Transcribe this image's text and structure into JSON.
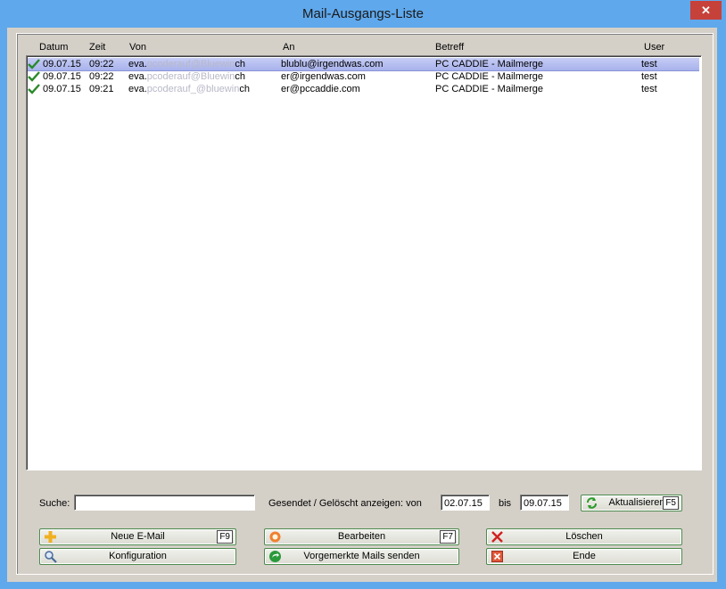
{
  "window": {
    "title": "Mail-Ausgangs-Liste",
    "close_glyph": "✕"
  },
  "columns": [
    "Datum",
    "Zeit",
    "Von",
    "An",
    "Betreff",
    "User"
  ],
  "rows": [
    {
      "datum": "09.07.15",
      "zeit": "09:22",
      "von_start": "eva.",
      "von_blur": "pcoderauf@Bluewin",
      "von_end": "ch",
      "an": "blublu@irgendwas.com",
      "betreff": "PC CADDIE - Mailmerge",
      "user": "test",
      "selected": true
    },
    {
      "datum": "09.07.15",
      "zeit": "09:22",
      "von_start": "eva.",
      "von_blur": "pcoderauf@Bluewin",
      "von_end": "ch",
      "an": "er@irgendwas.com",
      "betreff": "PC CADDIE - Mailmerge",
      "user": "test",
      "selected": false
    },
    {
      "datum": "09.07.15",
      "zeit": "09:21",
      "von_start": "eva.",
      "von_blur": "pcoderauf_@bluewin",
      "von_end": "ch",
      "an": "er@pccaddie.com",
      "betreff": "PC CADDIE - Mailmerge",
      "user": "test",
      "selected": false
    }
  ],
  "filter": {
    "search_label": "Suche:",
    "search_value": "",
    "sent_label": "Gesendet / Gelöscht anzeigen:  von",
    "from_value": "02.07.15",
    "to_label": "bis",
    "to_value": "09.07.15"
  },
  "buttons": {
    "refresh": {
      "label": "Aktualisieren",
      "key": "F5"
    },
    "new_mail": {
      "label": "Neue E-Mail",
      "key": "F9"
    },
    "edit": {
      "label": "Bearbeiten",
      "key": "F7"
    },
    "delete": {
      "label": "Löschen"
    },
    "config": {
      "label": "Konfiguration"
    },
    "send_queued": {
      "label": "Vorgemerkte Mails senden"
    },
    "end": {
      "label": "Ende"
    }
  },
  "colors": {
    "accent": "#5fa8ec",
    "close": "#c7413b",
    "check": "#2a8a2a",
    "selection": "#b4bdf0"
  }
}
